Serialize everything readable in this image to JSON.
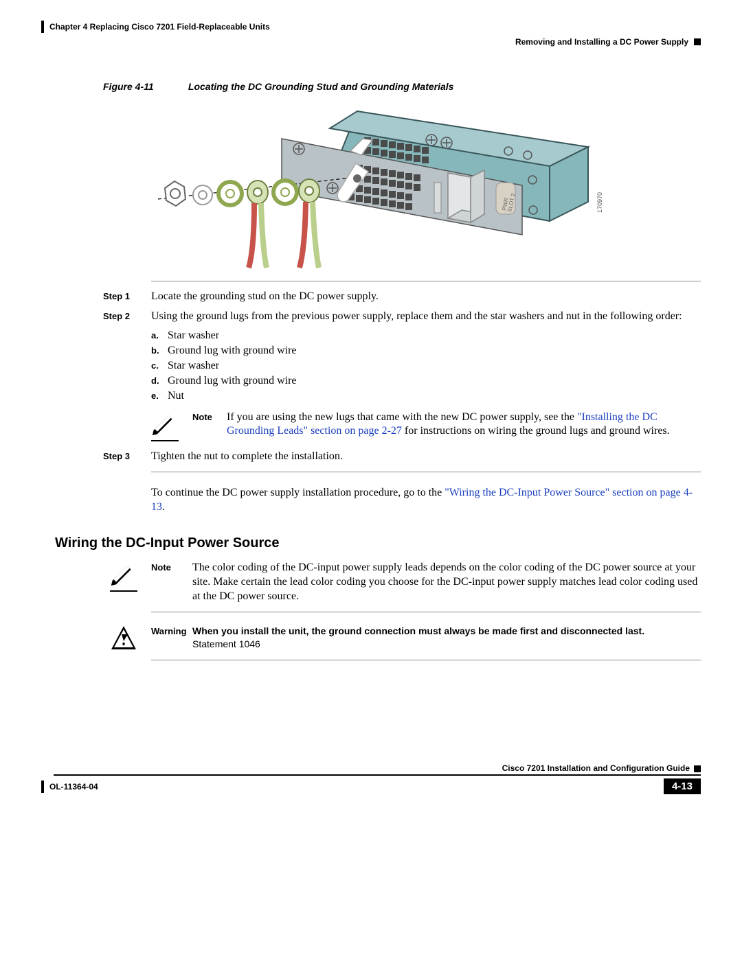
{
  "header": {
    "chapter": "Chapter 4    Replacing Cisco 7201 Field-Replaceable Units",
    "section": "Removing and Installing a DC Power Supply"
  },
  "figure": {
    "label": "Figure 4-11",
    "caption": "Locating the DC Grounding Stud and Grounding Materials",
    "drawing_id": "170970",
    "pwr_label_line1": "PWR",
    "pwr_label_line2": "SLOT 2"
  },
  "steps": {
    "s1": {
      "label": "Step 1",
      "text": "Locate the grounding stud on the DC power supply."
    },
    "s2": {
      "label": "Step 2",
      "text": "Using the ground lugs from the previous power supply, replace them and the star washers and nut in the following order:"
    },
    "sub": {
      "a": {
        "marker": "a.",
        "text": "Star washer"
      },
      "b": {
        "marker": "b.",
        "text": "Ground lug with ground wire"
      },
      "c": {
        "marker": "c.",
        "text": "Star washer"
      },
      "d": {
        "marker": "d.",
        "text": "Ground lug with ground wire"
      },
      "e": {
        "marker": "e.",
        "text": "Nut"
      }
    },
    "s3": {
      "label": "Step 3",
      "text": "Tighten the nut to complete the installation."
    }
  },
  "note_inline": {
    "label": "Note",
    "pre": "If you are using the new lugs that came with the new DC power supply, see the ",
    "link": "\"Installing the DC Grounding Leads\" section on page 2-27",
    "post": " for instructions on wiring the ground lugs and ground wires."
  },
  "continue": {
    "pre": "To continue the DC power supply installation procedure, go to the ",
    "link": "\"Wiring the DC-Input Power Source\" section on page 4-13",
    "post": "."
  },
  "section_heading": "Wiring the DC-Input Power Source",
  "note2": {
    "label": "Note",
    "text": "The color coding of the DC-input power supply leads depends on the color coding of the DC power source at your site. Make certain the lead color coding you choose for the DC-input power supply matches lead color coding used at the DC power source."
  },
  "warning": {
    "label": "Warning",
    "text": "When you install the unit, the ground connection must always be made first and disconnected last.",
    "statement": "Statement 1046"
  },
  "footer": {
    "title": "Cisco 7201 Installation and Configuration Guide",
    "doc": "OL-11364-04",
    "page": "4-13"
  }
}
